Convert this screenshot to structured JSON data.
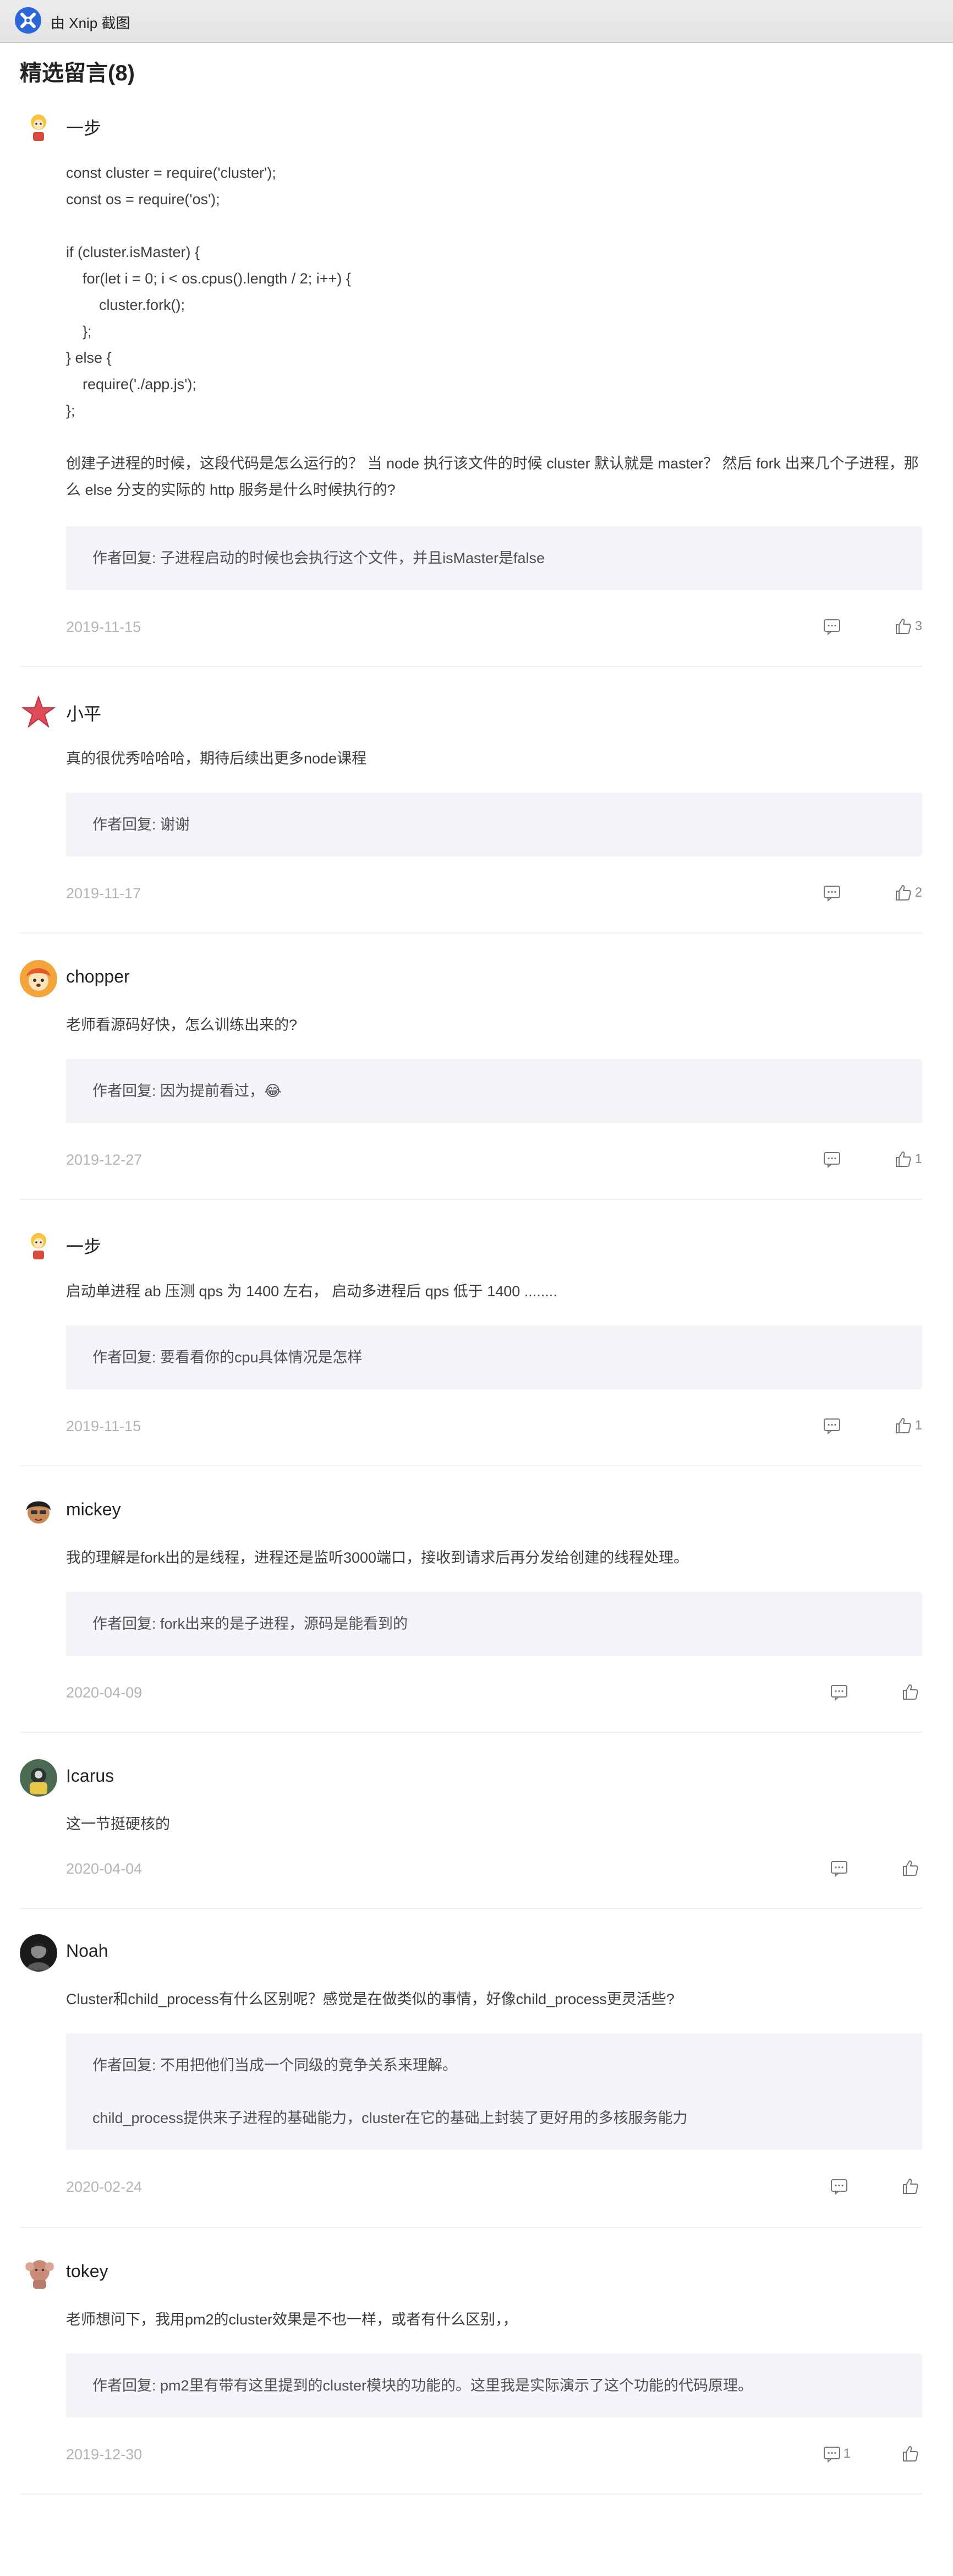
{
  "topbar": {
    "title": "由 Xnip 截图",
    "icon": "xnip-logo-icon"
  },
  "section_title": "精选留言(8)",
  "comments": [
    {
      "name": "一步",
      "body_code": [
        "const cluster = require('cluster');",
        "const os = require('os');",
        "",
        "if (cluster.isMaster) {",
        "    for(let i = 0; i < os.cpus().length / 2; i++) {",
        "        cluster.fork();",
        "    };",
        "} else {",
        "    require('./app.js');",
        "};",
        ""
      ],
      "body": "创建子进程的时候，这段代码是怎么运行的？ 当 node 执行该文件的时候 cluster 默认就是 master？ 然后 fork 出来几个子进程，那么 else 分支的实际的 http 服务是什么时候执行的?",
      "reply": [
        "作者回复: 子进程启动的时候也会执行这个文件，并且isMaster是false"
      ],
      "date": "2019-11-15",
      "comment_count": "",
      "like_count": "3"
    },
    {
      "name": "小平",
      "body": "真的很优秀哈哈哈，期待后续出更多node课程",
      "reply": [
        "作者回复: 谢谢"
      ],
      "date": "2019-11-17",
      "comment_count": "",
      "like_count": "2"
    },
    {
      "name": "chopper",
      "body": "老师看源码好快，怎么训练出来的?",
      "reply": [
        "作者回复: 因为提前看过，😂"
      ],
      "date": "2019-12-27",
      "comment_count": "",
      "like_count": "1"
    },
    {
      "name": "一步",
      "body": "启动单进程 ab 压测 qps 为 1400 左右， 启动多进程后 qps 低于 1400 ........",
      "reply": [
        "作者回复: 要看看你的cpu具体情况是怎样"
      ],
      "date": "2019-11-15",
      "comment_count": "",
      "like_count": "1"
    },
    {
      "name": "mickey",
      "body": "我的理解是fork出的是线程，进程还是监听3000端口，接收到请求后再分发给创建的线程处理。",
      "reply": [
        "作者回复: fork出来的是子进程，源码是能看到的"
      ],
      "date": "2020-04-09",
      "comment_count": "",
      "like_count": ""
    },
    {
      "name": "Icarus",
      "body": "这一节挺硬核的",
      "reply": [],
      "date": "2020-04-04",
      "comment_count": "",
      "like_count": ""
    },
    {
      "name": "Noah",
      "body": "Cluster和child_process有什么区别呢？感觉是在做类似的事情，好像child_process更灵活些?",
      "reply": [
        "作者回复: 不用把他们当成一个同级的竞争关系来理解。",
        "child_process提供来子进程的基础能力，cluster在它的基础上封装了更好用的多核服务能力"
      ],
      "date": "2020-02-24",
      "comment_count": "",
      "like_count": ""
    },
    {
      "name": "tokey",
      "body": "老师想问下，我用pm2的cluster效果是不也一样，或者有什么区别，，",
      "reply": [
        "作者回复: pm2里有带有这里提到的cluster模块的功能的。这里我是实际演示了这个功能的代码原理。"
      ],
      "date": "2019-12-30",
      "comment_count": "1",
      "like_count": ""
    }
  ],
  "colors": {
    "reply_bg": "#f4f5f9",
    "date": "#b4b4b4",
    "divider": "#eeeeee"
  }
}
